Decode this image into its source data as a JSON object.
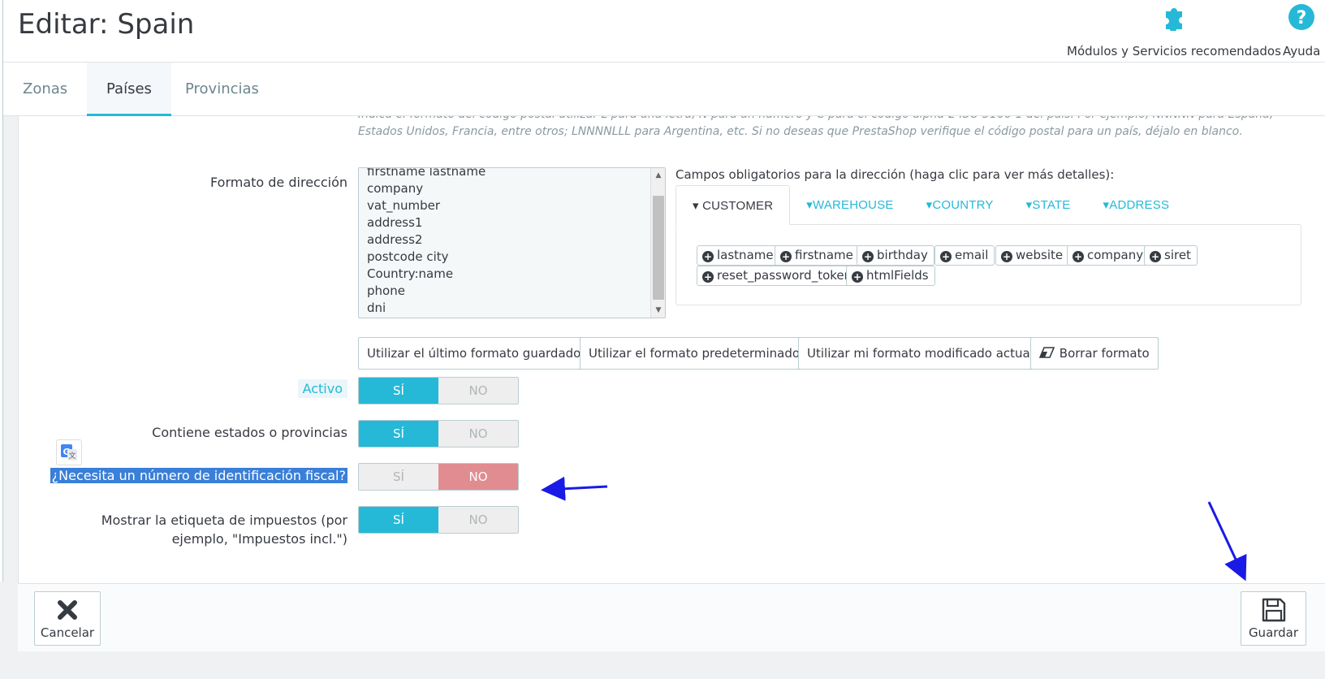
{
  "header": {
    "title": "Editar: Spain",
    "modules_label": "Módulos y Servicios recomendados",
    "help_label": "Ayuda"
  },
  "tabs": [
    "Zonas",
    "Países",
    "Provincias"
  ],
  "help_text": "Indica el formato del código postal utilizar L para una letra, N para un número y C para el código alpha-2 ISO 3166-1 del país. Por ejemplo, NNNNN para España, Estados Unidos, Francia, entre otros; LNNNNLLL para Argentina, etc. Si no deseas que PrestaShop verifique el código postal para un país, déjalo en blanco.",
  "address_format": {
    "label": "Formato de dirección",
    "lines": [
      "firstname lastname",
      "company",
      "vat_number",
      "address1",
      "address2",
      "postcode city",
      "Country:name",
      "phone",
      "dni"
    ]
  },
  "required_fields": {
    "label": "Campos obligatorios para la dirección (haga clic para ver más detalles):",
    "tabs": [
      "CUSTOMER",
      "WAREHOUSE",
      "COUNTRY",
      "STATE",
      "ADDRESS"
    ],
    "fields": [
      "lastname",
      "firstname",
      "birthday",
      "email",
      "website",
      "company",
      "siret",
      "reset_password_token",
      "htmlFields"
    ]
  },
  "format_buttons": {
    "last_saved": "Utilizar el último formato guardado",
    "default": "Utilizar el formato predeterminado",
    "current": "Utilizar mi formato modificado actual",
    "clear": "Borrar formato"
  },
  "switches": {
    "yes": "SÍ",
    "no": "NO",
    "activo": {
      "label": "Activo",
      "value": "yes"
    },
    "states": {
      "label": "Contiene estados o provincias",
      "value": "yes"
    },
    "tax_id": {
      "label": "¿Necesita un número de identificación fiscal?",
      "value": "no"
    },
    "tax_label_line1": "Mostrar la etiqueta de impuestos (por",
    "tax_label_line2": "ejemplo, \"Impuestos incl.\")",
    "tax_label_value": "yes"
  },
  "footer": {
    "cancel": "Cancelar",
    "save": "Guardar"
  },
  "colors": {
    "accent": "#25b9d7",
    "no_active": "#e08c91",
    "annotation_arrow": "#1a1ae6"
  }
}
